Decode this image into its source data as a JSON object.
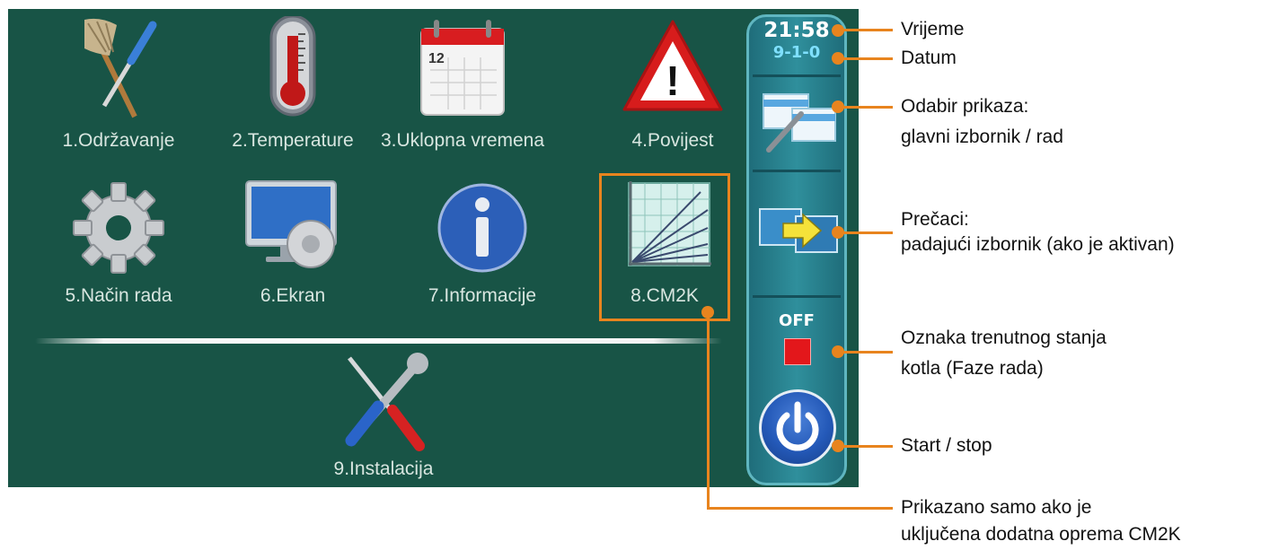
{
  "screen": {
    "menu": [
      {
        "label": "1.Održavanje",
        "icon": "broom-screwdriver-icon"
      },
      {
        "label": "2.Temperature",
        "icon": "thermometer-icon"
      },
      {
        "label": "3.Uklopna vremena",
        "icon": "calendar-icon"
      },
      {
        "label": "4.Povijest",
        "icon": "warning-triangle-icon"
      },
      {
        "label": "5.Način rada",
        "icon": "gear-icon"
      },
      {
        "label": "6.Ekran",
        "icon": "monitor-settings-icon"
      },
      {
        "label": "7.Informacije",
        "icon": "info-icon"
      },
      {
        "label": "8.CM2K",
        "icon": "chart-lines-icon"
      },
      {
        "label": "9.Instalacija",
        "icon": "wrench-screwdriver-icon"
      }
    ],
    "sidebar": {
      "time": "21:58",
      "date": "9-1-0",
      "status": "OFF",
      "colors": {
        "status_square": "#e3171b",
        "power": "#2459b8"
      }
    },
    "calendar_day": "12",
    "warning_mark": "!"
  },
  "callouts": {
    "time": "Vrijeme",
    "date": "Datum",
    "view_line1": "Odabir prikaza:",
    "view_line2": "glavni izbornik / rad",
    "shortcuts_line1": "Prečaci:",
    "shortcuts_line2": "padajući izbornik (ako je aktivan)",
    "state_line1": "Oznaka trenutnog stanja",
    "state_line2": "kotla (Faze rada)",
    "startstop": "Start / stop",
    "cm2k_line1": "Prikazano samo ako je",
    "cm2k_line2": "uključena dodatna oprema CM2K"
  },
  "colors": {
    "screen_bg": "#185446",
    "callout": "#e8841e"
  }
}
